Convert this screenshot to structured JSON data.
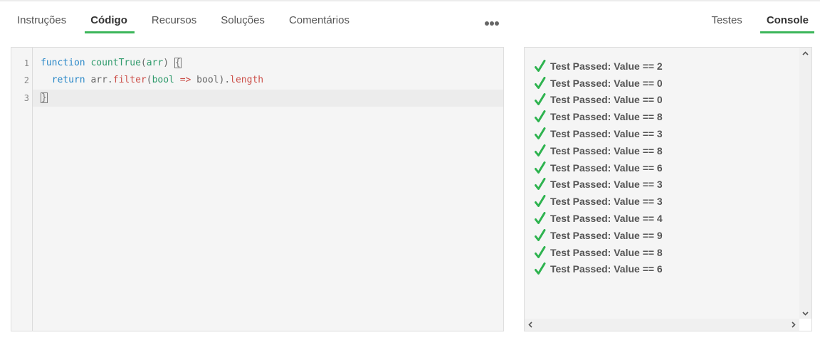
{
  "tabs_left": [
    {
      "label": "Instruções",
      "active": false
    },
    {
      "label": "Código",
      "active": true
    },
    {
      "label": "Recursos",
      "active": false
    },
    {
      "label": "Soluções",
      "active": false
    },
    {
      "label": "Comentários",
      "active": false
    }
  ],
  "more_icon": "more-dots-icon",
  "tabs_right": [
    {
      "label": "Testes",
      "active": false
    },
    {
      "label": "Console",
      "active": true
    }
  ],
  "colors": {
    "accent": "#3cb65a",
    "keyword": "#2a88c8",
    "identifier": "#2e9a6b",
    "property": "#cc4e48",
    "check": "#2eb34f"
  },
  "editor": {
    "line_numbers": [
      "1",
      "2",
      "3"
    ],
    "lines": [
      "function countTrue(arr) {",
      "  return arr.filter(bool => bool).length",
      "}"
    ],
    "tokens": {
      "l1_kw": "function",
      "l1_sp1": " ",
      "l1_fn": "countTrue",
      "l1_paren_open": "(",
      "l1_arg": "arr",
      "l1_paren_close": ") ",
      "l1_brace": "{",
      "l2_indent": "  ",
      "l2_kw": "return",
      "l2_obj": " arr.",
      "l2_method": "filter",
      "l2_paren_open": "(",
      "l2_param": "bool",
      "l2_sp": " ",
      "l2_arrow": "=>",
      "l2_body": " bool).",
      "l2_prop": "length",
      "l3_brace": "}"
    }
  },
  "console": {
    "check_icon": "check-icon",
    "results": [
      "Test Passed: Value == 2",
      "Test Passed: Value == 0",
      "Test Passed: Value == 0",
      "Test Passed: Value == 8",
      "Test Passed: Value == 3",
      "Test Passed: Value == 8",
      "Test Passed: Value == 6",
      "Test Passed: Value == 3",
      "Test Passed: Value == 3",
      "Test Passed: Value == 4",
      "Test Passed: Value == 9",
      "Test Passed: Value == 8",
      "Test Passed: Value == 6"
    ]
  }
}
